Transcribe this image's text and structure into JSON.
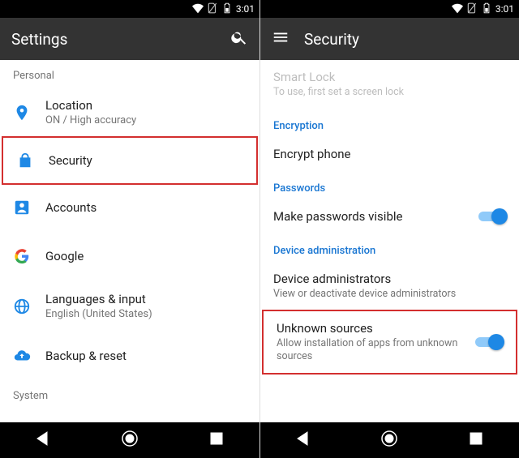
{
  "status": {
    "time": "3:01"
  },
  "left": {
    "appbar": {
      "title": "Settings"
    },
    "category_personal": "Personal",
    "items": [
      {
        "title": "Location",
        "subtitle": "ON / High accuracy"
      },
      {
        "title": "Security",
        "subtitle": ""
      },
      {
        "title": "Accounts",
        "subtitle": ""
      },
      {
        "title": "Google",
        "subtitle": ""
      },
      {
        "title": "Languages & input",
        "subtitle": "English (United States)"
      },
      {
        "title": "Backup & reset",
        "subtitle": ""
      }
    ],
    "category_system": "System"
  },
  "right": {
    "appbar": {
      "title": "Security"
    },
    "smart_lock": {
      "title": "Smart Lock",
      "subtitle": "To use, first set a screen lock"
    },
    "sections": {
      "encryption": {
        "header": "Encryption",
        "item": {
          "title": "Encrypt phone"
        }
      },
      "passwords": {
        "header": "Passwords",
        "item": {
          "title": "Make passwords visible",
          "switch": true
        }
      },
      "device_admin": {
        "header": "Device administration",
        "admins": {
          "title": "Device administrators",
          "subtitle": "View or deactivate device administrators"
        },
        "unknown": {
          "title": "Unknown sources",
          "subtitle": "Allow installation of apps from unknown sources",
          "switch": true
        }
      }
    }
  }
}
